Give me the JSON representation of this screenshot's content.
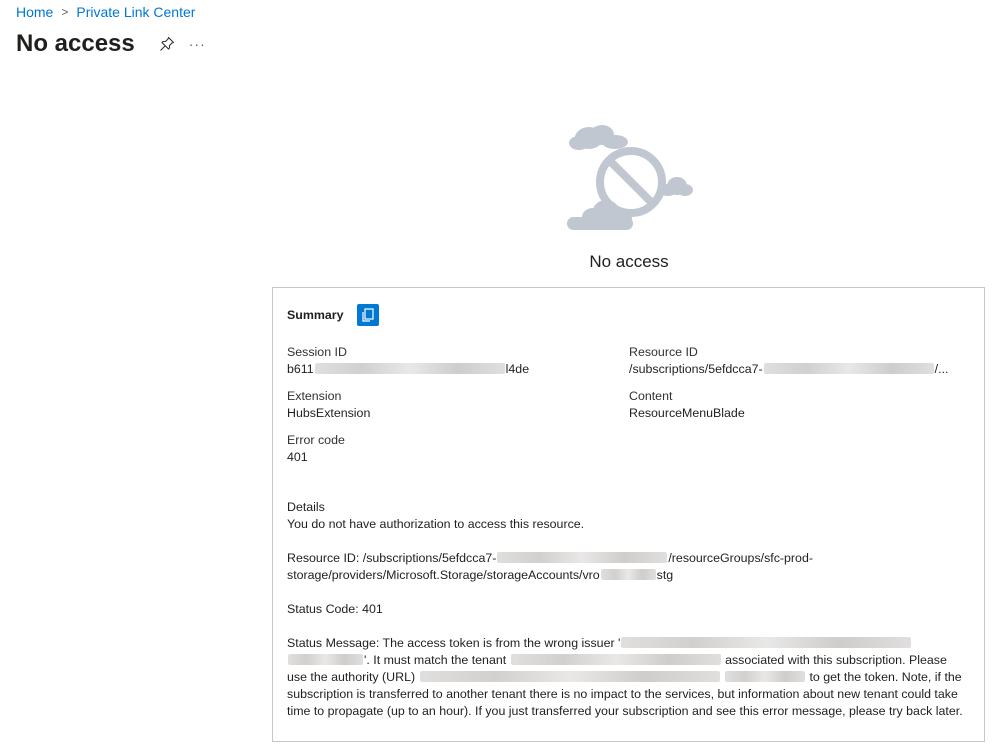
{
  "breadcrumb": {
    "home": "Home",
    "separator": ">",
    "current": "Private Link Center"
  },
  "page": {
    "title": "No access",
    "more": "···"
  },
  "hero": {
    "label": "No access"
  },
  "summary": {
    "title": "Summary",
    "session_id": {
      "label": "Session ID",
      "prefix": "b611",
      "suffix": "l4de"
    },
    "resource_id": {
      "label": "Resource ID",
      "prefix": "/subscriptions/5efdcca7-",
      "suffix": "/..."
    },
    "extension": {
      "label": "Extension",
      "value": "HubsExtension"
    },
    "content": {
      "label": "Content",
      "value": "ResourceMenuBlade"
    },
    "error_code": {
      "label": "Error code",
      "value": "401"
    }
  },
  "details": {
    "label": "Details",
    "message": "You do not have authorization to access this resource.",
    "resource_prefix": "Resource ID: /subscriptions/5efdcca7-",
    "resource_mid": "/resourceGroups/sfc-prod-storage/providers/Microsoft.Storage/storageAccounts/vro",
    "resource_suffix": "stg",
    "status_code": "Status Code: 401",
    "status_msg_1": "Status Message: The access token is from the wrong issuer '",
    "status_msg_2": "'. It must match the tenant ",
    "status_msg_3": " associated with this subscription. Please use the authority (URL) ",
    "status_msg_4": " to get the token. Note, if the subscription is transferred to another tenant there is no impact to the services, but information about new tenant could take time to propagate (up to an hour). If you just transferred your subscription and see this error message, please try back later."
  },
  "colors": {
    "accent": "#0078d4",
    "icon_gray": "#c1c7d0",
    "border": "#c8c6c4"
  }
}
